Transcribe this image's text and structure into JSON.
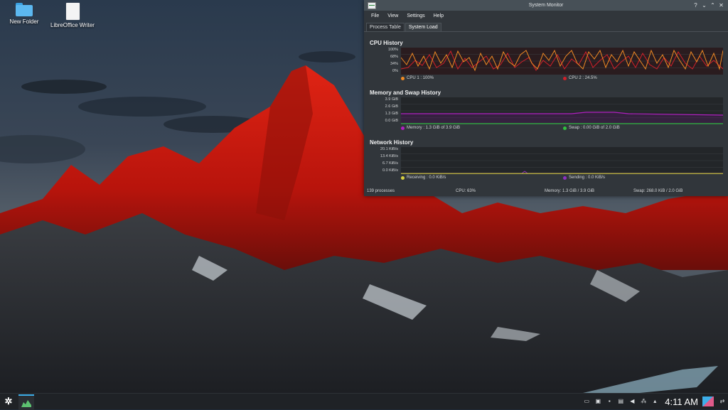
{
  "desktop": {
    "icons": [
      {
        "label": "New Folder",
        "icon": "folder-icon"
      },
      {
        "label": "LibreOffice Writer",
        "icon": "document-icon"
      }
    ]
  },
  "window": {
    "title": "System Monitor",
    "controls": {
      "help": "?",
      "minimize": "⌄",
      "maximize": "⌃",
      "close": "✕"
    },
    "menu": [
      "File",
      "View",
      "Settings",
      "Help"
    ],
    "tabs": [
      "Process Table",
      "System Load"
    ],
    "active_tab": "System Load",
    "cpu": {
      "title": "CPU History",
      "ylabels": [
        "100%",
        "68%",
        "34%",
        "0%"
      ],
      "legend": [
        {
          "label": "CPU 1 : 100%",
          "color": "#f08a24"
        },
        {
          "label": "CPU 2 : 24.5%",
          "color": "#d0202a"
        }
      ]
    },
    "memory": {
      "title": "Memory and Swap History",
      "ylabels": [
        "3.9 GiB",
        "2.6 GiB",
        "1.3 GiB",
        "0.0 GiB"
      ],
      "legend": [
        {
          "label": "Memory : 1.3 GiB of 3.9 GiB",
          "color": "#b020c0"
        },
        {
          "label": "Swap : 0.00 GiB of 2.0 GiB",
          "color": "#30c040"
        }
      ]
    },
    "network": {
      "title": "Network History",
      "ylabels": [
        "20.1 KiB/s",
        "13.4 KiB/s",
        "6.7 KiB/s",
        "0.0 KiB/s"
      ],
      "legend": [
        {
          "label": "Receiving : 0.0 KiB/s",
          "color": "#d8d040"
        },
        {
          "label": "Sending : 0.0 KiB/s",
          "color": "#9030c0"
        }
      ]
    },
    "status": {
      "processes": "139 processes",
      "cpu": "CPU: 63%",
      "memory": "Memory: 1.3 GiB / 3.9 GiB",
      "swap": "Swap: 268.0 KiB / 2.0 GiB"
    }
  },
  "taskbar": {
    "clock": "4:11 AM",
    "launcher_icon": "kde-launcher-icon",
    "tray_icons": [
      "display-icon",
      "device-icon",
      "lock-icon",
      "clipboard-icon",
      "volume-icon",
      "network-icon",
      "expand-tray-icon"
    ],
    "accent": "#3daee9"
  },
  "colors": {
    "window_bg": "#31363b",
    "graph_bg": "#232629",
    "mountain_red": "#c8180e"
  }
}
